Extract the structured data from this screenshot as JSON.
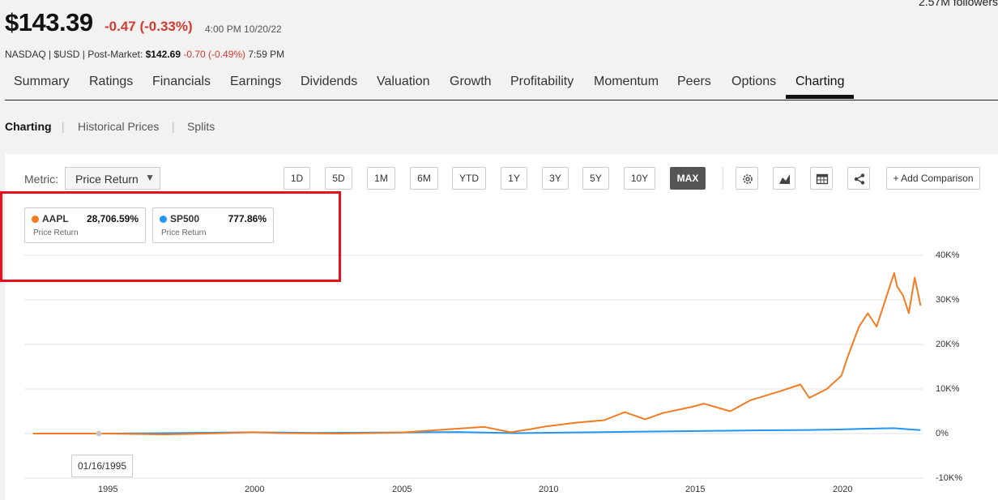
{
  "header": {
    "followers": "2.57M followers",
    "price": "$143.39",
    "change": "-0.47 (-0.33%)",
    "time": "4:00 PM 10/20/22",
    "exchange": "NASDAQ | $USD | Post-Market: ",
    "post_price": "$142.69",
    "post_change": " -0.70 (-0.49%)",
    "post_time": " 7:59 PM"
  },
  "tabs": [
    "Summary",
    "Ratings",
    "Financials",
    "Earnings",
    "Dividends",
    "Valuation",
    "Growth",
    "Profitability",
    "Momentum",
    "Peers",
    "Options",
    "Charting"
  ],
  "active_tab": "Charting",
  "subnav": [
    "Charting",
    "Historical Prices",
    "Splits"
  ],
  "toolbar": {
    "metric_label": "Metric:",
    "metric_value": "Price Return",
    "metric_caret": "▼",
    "ranges": [
      "1D",
      "5D",
      "1M",
      "6M",
      "YTD",
      "1Y",
      "3Y",
      "5Y",
      "10Y",
      "MAX"
    ],
    "active_range": "MAX",
    "add_comparison": "+ Add Comparison",
    "icons": [
      "gear-icon",
      "chart-type-icon",
      "table-icon",
      "share-icon"
    ]
  },
  "legend": [
    {
      "name": "AAPL",
      "value": "28,706.59%",
      "desc": "Price Return",
      "color": "#f47b20"
    },
    {
      "name": "SP500",
      "value": "777.86%",
      "desc": "Price Return",
      "color": "#2196f3"
    }
  ],
  "tooltip": "01/16/1995",
  "chart_data": {
    "type": "line",
    "title": "",
    "xlabel": "",
    "ylabel": "",
    "x_ticks": [
      "1995",
      "2000",
      "2005",
      "2010",
      "2015",
      "2020"
    ],
    "y_ticks": [
      "40K%",
      "30K%",
      "20K%",
      "10K%",
      "0%",
      "-10K%"
    ],
    "ylim": [
      -10000,
      40000
    ],
    "xlim": [
      1992.2,
      2022.9
    ],
    "grid": true,
    "series": [
      {
        "name": "AAPL",
        "color": "#f47b20",
        "x": [
          1992.5,
          1995,
          1997,
          1999,
          2000,
          2001,
          2003,
          2005,
          2007.9,
          2008.8,
          2009.5,
          2010,
          2011,
          2012,
          2012.7,
          2013.4,
          2014,
          2015,
          2015.4,
          2016.3,
          2017,
          2018,
          2018.7,
          2019,
          2019.6,
          2020.1,
          2020.3,
          2020.7,
          2021,
          2021.3,
          2021.6,
          2021.9,
          2022,
          2022.2,
          2022.4,
          2022.6,
          2022.8
        ],
        "y": [
          0,
          0,
          -200,
          100,
          300,
          100,
          0,
          200,
          1500,
          300,
          1000,
          1600,
          2400,
          3000,
          4800,
          3200,
          4600,
          6000,
          6700,
          5000,
          7500,
          9500,
          11000,
          8000,
          10000,
          13000,
          17000,
          24000,
          27000,
          24000,
          30000,
          36000,
          33000,
          31000,
          27000,
          35000,
          28700
        ]
      },
      {
        "name": "SP500",
        "color": "#2196f3",
        "x": [
          1992.5,
          1995,
          1997,
          2000,
          2002,
          2005,
          2007,
          2009,
          2011,
          2013,
          2015,
          2017,
          2019,
          2020,
          2021,
          2021.9,
          2022.3,
          2022.8
        ],
        "y": [
          0,
          0,
          100,
          300,
          150,
          250,
          350,
          100,
          250,
          400,
          550,
          700,
          800,
          900,
          1100,
          1200,
          1000,
          778
        ]
      }
    ]
  }
}
